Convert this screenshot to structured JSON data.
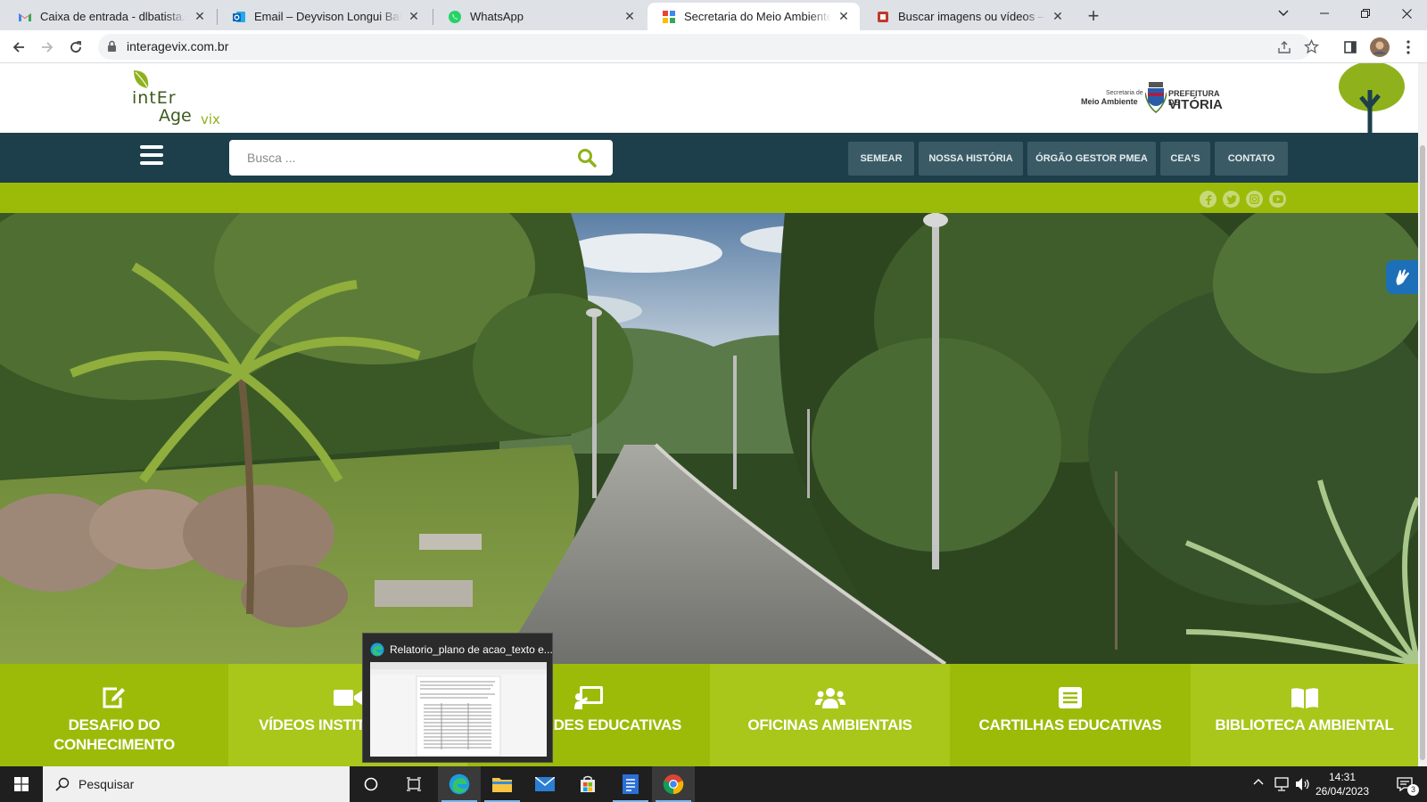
{
  "browser": {
    "tabs": [
      {
        "title": "Caixa de entrada - dlbatista.secom",
        "favicon": "gmail-icon"
      },
      {
        "title": "Email – Deyvison Longui Batista – Ou",
        "favicon": "outlook-icon"
      },
      {
        "title": "WhatsApp",
        "favicon": "whatsapp-icon"
      },
      {
        "title": "Secretaria do Meio Ambiente - Vitória",
        "favicon": "google-sites-icon",
        "active": true
      },
      {
        "title": "Buscar imagens ou vídeos – Gerenc",
        "favicon": "gerenc-icon"
      }
    ],
    "new_tab_label": "+",
    "url": "interagevix.com.br"
  },
  "site": {
    "logo": {
      "line1": "intEr",
      "line2": "Age",
      "line3": "vix"
    },
    "prefeitura": {
      "sec_small": "Secretaria de",
      "sec_main": "Meio Ambiente",
      "pref_small": "PREFEITURA DE",
      "pref_main": "VITÓRIA"
    },
    "search_placeholder": "Busca ...",
    "menu": [
      "SEMEAR",
      "NOSSA HISTÓRIA",
      "ÓRGÃO GESTOR PMEA",
      "CEA'S",
      "CONTATO"
    ],
    "social": [
      "facebook-icon",
      "twitter-icon",
      "instagram-icon",
      "youtube-icon"
    ],
    "tiles": [
      {
        "label_1": "DESAFIO DO",
        "label_2": "CONHECIMENTO",
        "icon": "edit-icon",
        "color": "#9cbb09"
      },
      {
        "label_1": "VÍDEOS INSTITUCIONAIS",
        "label_2": "",
        "icon": "video-camera-icon",
        "color": "#a9c61a"
      },
      {
        "label_1": "ATIVIDADES EDUCATIVAS",
        "label_2": "",
        "icon": "presentation-icon",
        "color": "#9cbb09"
      },
      {
        "label_1": "OFICINAS AMBIENTAIS",
        "label_2": "",
        "icon": "users-icon",
        "color": "#a9c61a"
      },
      {
        "label_1": "CARTILHAS EDUCATIVAS",
        "label_2": "",
        "icon": "list-icon",
        "color": "#9cbb09"
      },
      {
        "label_1": "BIBLIOTECA AMBIENTAL",
        "label_2": "",
        "icon": "book-icon",
        "color": "#a9c61a"
      }
    ]
  },
  "taskbar_preview": {
    "title": "Relatorio_plano de acao_texto e..."
  },
  "taskbar": {
    "search_placeholder": "Pesquisar",
    "time": "14:31",
    "date": "26/04/2023",
    "notifications": "3"
  }
}
